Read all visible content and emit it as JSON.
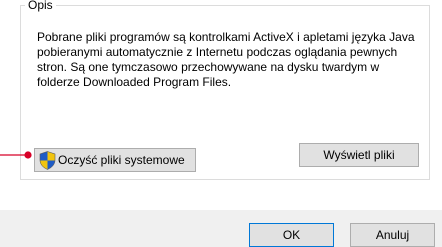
{
  "group": {
    "legend": "Opis",
    "description": "Pobrane pliki programów są kontrolkami ActiveX i apletami języka Java pobieranymi automatycznie z Internetu podczas oglądania pewnych stron. Są one tymczasowo przechowywane na dysku twardym w folderze Downloaded Program Files."
  },
  "buttons": {
    "clear_label": "Oczyść pliki systemowe",
    "view_label": "Wyświetl pliki",
    "ok_label": "OK",
    "cancel_label": "Anuluj"
  },
  "icons": {
    "clear_button_icon": "uac-shield-icon"
  },
  "colors": {
    "marker": "#d80027",
    "focus_border": "#0078d7"
  }
}
